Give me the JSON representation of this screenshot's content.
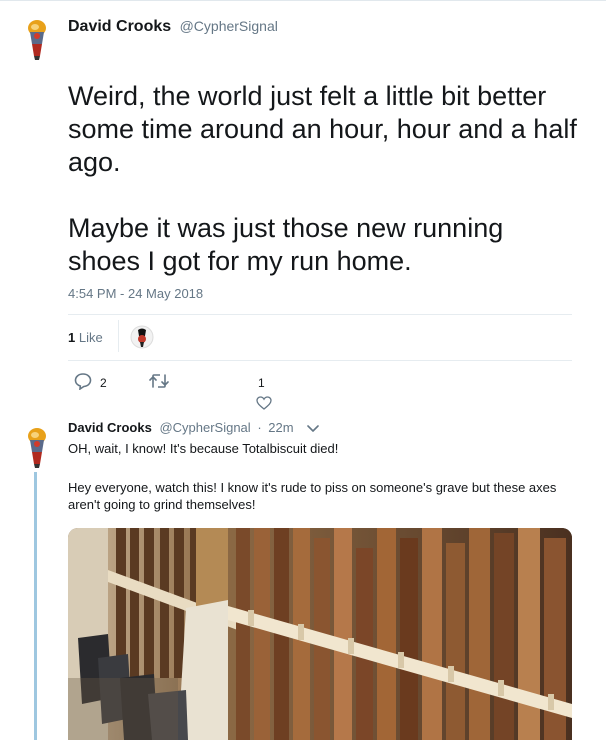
{
  "tweet": {
    "author_name": "David Crooks",
    "author_handle": "@CypherSignal",
    "text_p1": "Weird, the world just felt a little bit better some time around an hour, hour and a half ago.",
    "text_p2": "Maybe it was just those new running shoes I got for my run home.",
    "timestamp": "4:54 PM - 24 May 2018",
    "likes_count": "1",
    "likes_label": "Like",
    "reply_count": "2",
    "retweet_count": "",
    "like_count": "1"
  },
  "reply": {
    "author_name": "David Crooks",
    "author_handle": "@CypherSignal",
    "separator": "·",
    "time": "22m",
    "text_p1": "OH, wait, I know! It's because Totalbiscuit died!",
    "text_p2": "Hey everyone, watch this! I know it's rude to piss on someone's grave but these axes aren't going to grind themselves!"
  },
  "icons": {
    "reply": "speech-bubble-icon",
    "retweet": "retweet-arrows-icon",
    "like": "heart-icon",
    "more": "chevron-down-icon"
  },
  "colors": {
    "text_primary": "#14171a",
    "text_secondary": "#657786",
    "thread_line": "#9ec7e0",
    "divider": "#e6ecf0"
  }
}
